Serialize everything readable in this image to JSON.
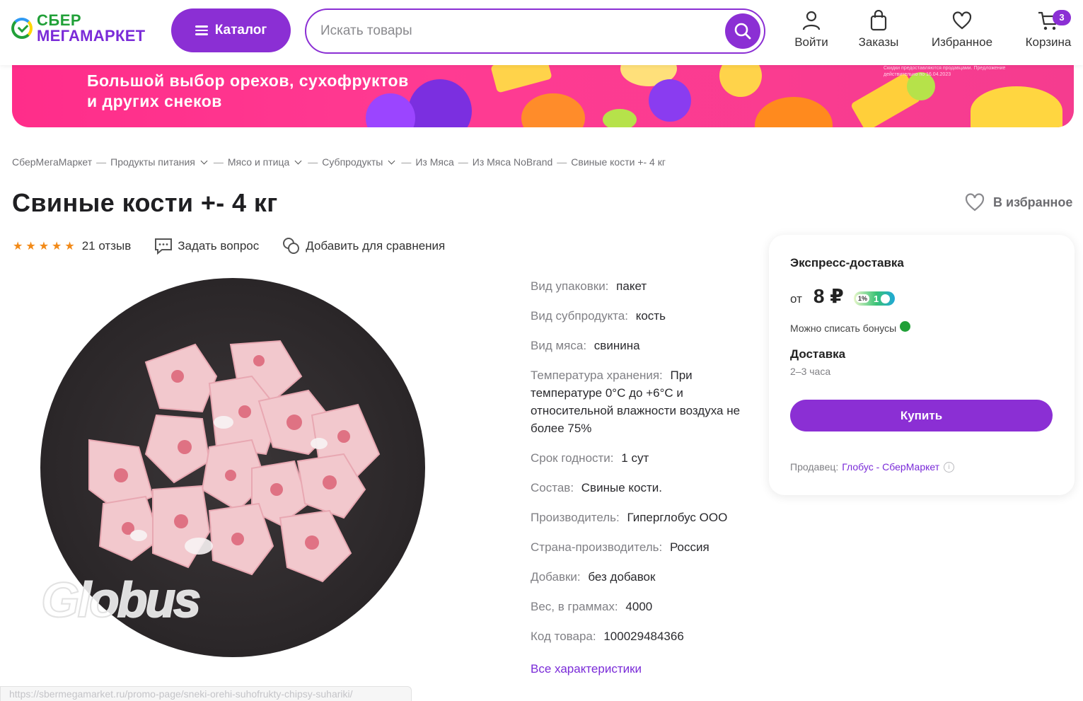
{
  "header": {
    "logo_line1": "СБЕР",
    "logo_line2": "МЕГАМАРКЕТ",
    "catalog_label": "Каталог",
    "search_placeholder": "Искать товары",
    "login_label": "Войти",
    "orders_label": "Заказы",
    "favorites_label": "Избранное",
    "cart_label": "Корзина",
    "cart_count": "3",
    "icons": [
      "user-icon",
      "bag-icon",
      "heart-icon",
      "cart-icon",
      "search-icon",
      "menu-icon"
    ]
  },
  "banner": {
    "line1": "Большой выбор орехов, сухофруктов",
    "line2": "и других снеков",
    "fine_print1": "Скидки предоставляются продавцами. Предложение",
    "fine_print2": "действительно по 16.04.2023"
  },
  "breadcrumb": {
    "items": [
      "СберМегаМаркет",
      "Продукты питания",
      "Мясо и птица",
      "Субпродукты",
      "Из Мяса",
      "Из Мяса NoBrand",
      "Свиные кости +- 4 кг"
    ],
    "separator": "—"
  },
  "product": {
    "title": "Свиные кости +- 4 кг",
    "favorite_label": "В избранное",
    "rating_stars": 5,
    "reviews_label": "21 отзыв",
    "ask_label": "Задать вопрос",
    "compare_label": "Добавить для сравнения",
    "image_watermark": "Globus"
  },
  "specs": [
    {
      "key": "Вид упаковки:",
      "value": "пакет"
    },
    {
      "key": "Вид субпродукта:",
      "value": "кость"
    },
    {
      "key": "Вид мяса:",
      "value": "свинина"
    },
    {
      "key": "Температура хранения:",
      "value": "При температуре 0°С до +6°С и относительной влажности воздуха не более 75%"
    },
    {
      "key": "Срок годности:",
      "value": "1 сут"
    },
    {
      "key": "Состав:",
      "value": "Свиные кости."
    },
    {
      "key": "Производитель:",
      "value": "Гиперглобус ООО"
    },
    {
      "key": "Страна-производитель:",
      "value": "Россия"
    },
    {
      "key": "Добавки:",
      "value": "без добавок"
    },
    {
      "key": "Вес, в граммах:",
      "value": "4000"
    },
    {
      "key": "Код товара:",
      "value": "100029484366"
    }
  ],
  "all_specs_label": "Все характеристики",
  "buybox": {
    "title": "Экспресс-доставка",
    "price_prefix": "от",
    "price": "8 ₽",
    "bonus_percent": "1%",
    "bonus_amount": "1",
    "bonus_note": "Можно списать бонусы",
    "delivery_label": "Доставка",
    "delivery_time": "2–3 часа",
    "buy_label": "Купить",
    "seller_prefix": "Продавец:",
    "seller_name": "Глобус - СберМаркет"
  },
  "status_bar_url": "https://sbermegamarket.ru/promo-page/sneki-orehi-suhofrukty-chipsy-suhariki/",
  "colors": {
    "brand_purple": "#8b2fd4",
    "sber_green": "#21a038",
    "banner_pink": "#ff2d8a",
    "star_orange": "#f28a18"
  }
}
